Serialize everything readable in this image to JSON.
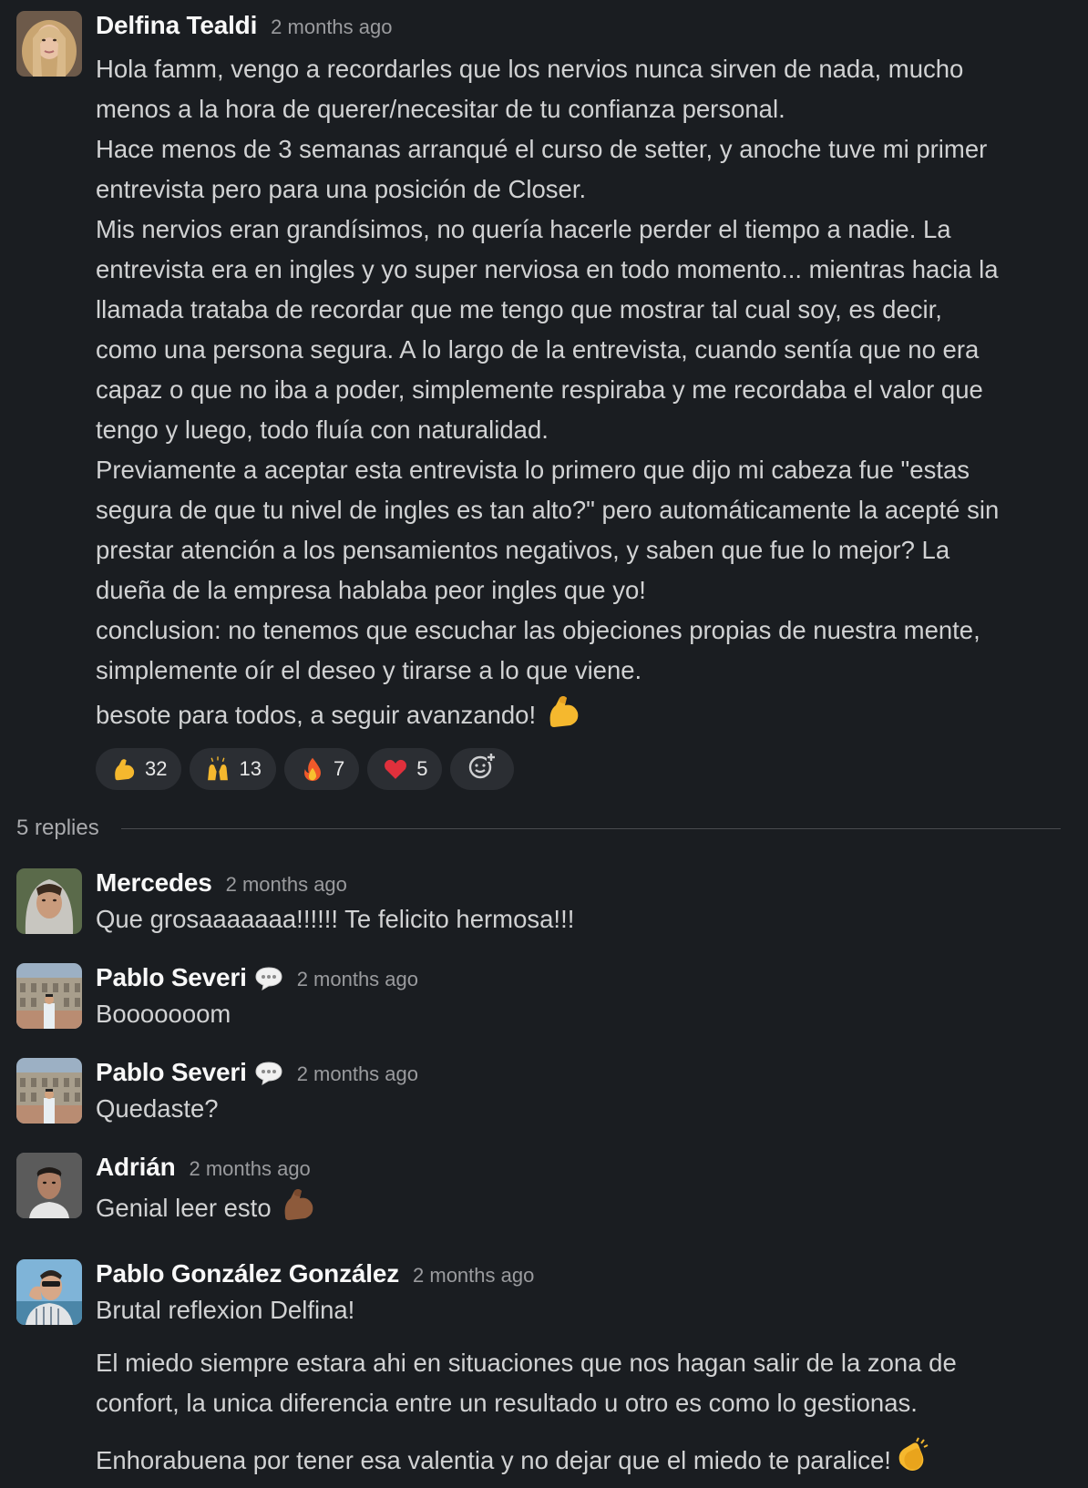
{
  "main": {
    "author": "Delfina Tealdi",
    "time": "2 months ago",
    "lines": [
      "Hola famm, vengo a recordarles que los nervios nunca sirven de nada, mucho",
      "menos a la hora de querer/necesitar de tu confianza personal.",
      "Hace menos de 3 semanas arranqué el curso de setter, y anoche tuve mi primer",
      "entrevista pero para una posición de Closer.",
      "Mis nervios eran grandísimos, no quería hacerle perder el tiempo a nadie. La",
      "entrevista era en ingles y yo super nerviosa en todo momento... mientras hacia la",
      "llamada trataba de recordar que me tengo que mostrar tal cual soy, es decir,",
      "como una persona segura. A lo largo de la entrevista, cuando sentía que no era",
      "capaz o que no iba a poder, simplemente respiraba y me recordaba el valor que",
      "tengo y luego, todo fluía con naturalidad.",
      "Previamente a aceptar esta entrevista lo primero que dijo mi cabeza fue \"estas",
      "segura de que tu nivel de ingles es tan alto?\" pero automáticamente la acepté sin",
      "prestar atención a los pensamientos negativos, y saben que fue lo mejor? La",
      "dueña de la empresa hablaba peor ingles que yo!",
      "conclusion: no tenemos que escuchar las objeciones propias de nuestra mente,",
      "simplemente oír el deseo y tirarse a lo que viene."
    ],
    "last_line": "besote para todos, a seguir avanzando!",
    "last_line_emoji": "flexed-biceps-icon",
    "reactions": [
      {
        "icon": "flexed-biceps-icon",
        "count": "32"
      },
      {
        "icon": "raising-hands-icon",
        "count": "13"
      },
      {
        "icon": "fire-icon",
        "count": "7"
      },
      {
        "icon": "red-heart-icon",
        "count": "5"
      }
    ],
    "add_reaction_icon": "add-reaction-icon"
  },
  "replies_label": "5 replies",
  "replies": [
    {
      "author": "Mercedes",
      "time": "2 months ago",
      "text": "Que grosaaaaaaa!!!!!! Te felicito hermosa!!!"
    },
    {
      "author": "Pablo Severi",
      "time": "2 months ago",
      "text": "Booooooom",
      "badge": "speech-bubble-icon"
    },
    {
      "author": "Pablo Severi",
      "time": "2 months ago",
      "text": "Quedaste?",
      "badge": "speech-bubble-icon"
    },
    {
      "author": "Adrián",
      "time": "2 months ago",
      "text": "Genial leer esto",
      "text_emoji": "flexed-biceps-medium-dark-icon"
    },
    {
      "author": "Pablo González González",
      "time": "2 months ago",
      "text": "Brutal reflexion Delfina!",
      "para2_line1": "El miedo siempre estara ahi en situaciones que nos hagan salir de la zona de",
      "para2_line2": "confort, la unica diferencia entre un resultado u otro es como lo gestionas.",
      "para3": "Enhorabuena por tener esa valentia y no dejar que el miedo te paralice!",
      "para3_emoji": "clapping-hands-icon"
    }
  ],
  "colors": {
    "background": "#1a1d21",
    "text": "#d1d2d3",
    "author": "#f8f8f8",
    "muted": "#9a9b9e",
    "pill": "#2b2e33"
  }
}
